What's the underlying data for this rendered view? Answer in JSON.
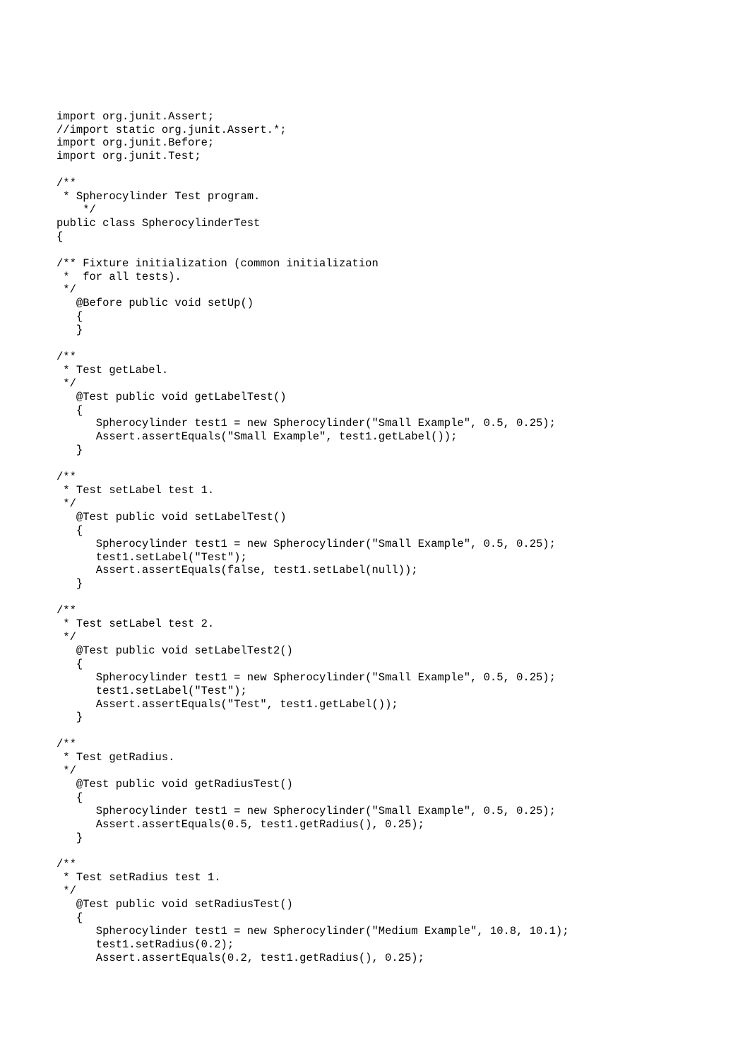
{
  "code": {
    "lines": [
      "import org.junit.Assert;",
      "//import static org.junit.Assert.*;",
      "import org.junit.Before;",
      "import org.junit.Test;",
      "",
      "/**",
      " * Spherocylinder Test program.",
      "    */",
      "public class SpherocylinderTest",
      "{",
      "",
      "/** Fixture initialization (common initialization",
      " *  for all tests).",
      " */",
      "   @Before public void setUp()",
      "   {",
      "   }",
      "",
      "/**",
      " * Test getLabel.",
      " */",
      "   @Test public void getLabelTest()",
      "   {",
      "      Spherocylinder test1 = new Spherocylinder(\"Small Example\", 0.5, 0.25);",
      "      Assert.assertEquals(\"Small Example\", test1.getLabel());",
      "   }",
      "",
      "/**",
      " * Test setLabel test 1.",
      " */",
      "   @Test public void setLabelTest()",
      "   {",
      "      Spherocylinder test1 = new Spherocylinder(\"Small Example\", 0.5, 0.25);",
      "      test1.setLabel(\"Test\");",
      "      Assert.assertEquals(false, test1.setLabel(null));",
      "   }",
      "",
      "/**",
      " * Test setLabel test 2.",
      " */",
      "   @Test public void setLabelTest2()",
      "   {",
      "      Spherocylinder test1 = new Spherocylinder(\"Small Example\", 0.5, 0.25);",
      "      test1.setLabel(\"Test\");",
      "      Assert.assertEquals(\"Test\", test1.getLabel());",
      "   }",
      "",
      "/**",
      " * Test getRadius.",
      " */",
      "   @Test public void getRadiusTest()",
      "   {",
      "      Spherocylinder test1 = new Spherocylinder(\"Small Example\", 0.5, 0.25);",
      "      Assert.assertEquals(0.5, test1.getRadius(), 0.25);",
      "   }",
      "",
      "/**",
      " * Test setRadius test 1.",
      " */",
      "   @Test public void setRadiusTest()",
      "   {",
      "      Spherocylinder test1 = new Spherocylinder(\"Medium Example\", 10.8, 10.1);",
      "      test1.setRadius(0.2);",
      "      Assert.assertEquals(0.2, test1.getRadius(), 0.25);"
    ]
  }
}
